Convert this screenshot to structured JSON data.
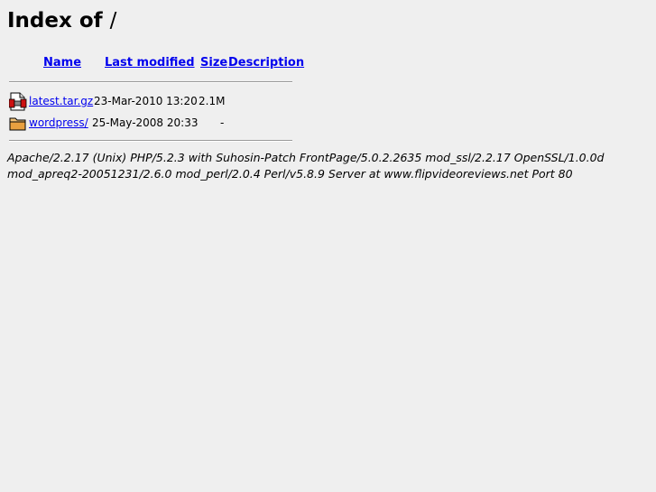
{
  "heading": {
    "prefix": "Index of",
    "path": "/"
  },
  "columns": {
    "name": "Name",
    "last_modified": "Last modified",
    "size": "Size",
    "description": "Description"
  },
  "rows": [
    {
      "icon": "compressed-file-icon",
      "name": "latest.tar.gz",
      "last_modified": "23-Mar-2010 13:20",
      "size": "2.1M",
      "description": ""
    },
    {
      "icon": "folder-icon",
      "name": "wordpress/",
      "last_modified": "25-May-2008 20:33",
      "size": "-",
      "description": ""
    }
  ],
  "server_signature": "Apache/2.2.17 (Unix) PHP/5.2.3 with Suhosin-Patch FrontPage/5.0.2.2635 mod_ssl/2.2.17 OpenSSL/1.0.0d mod_apreq2-20051231/2.6.0 mod_perl/2.0.4 Perl/v5.8.9 Server at www.flipvideoreviews.net Port 80",
  "colors": {
    "background": "#efefef",
    "link": "#0000ee",
    "text": "#000000",
    "folder": "#e8a040"
  }
}
